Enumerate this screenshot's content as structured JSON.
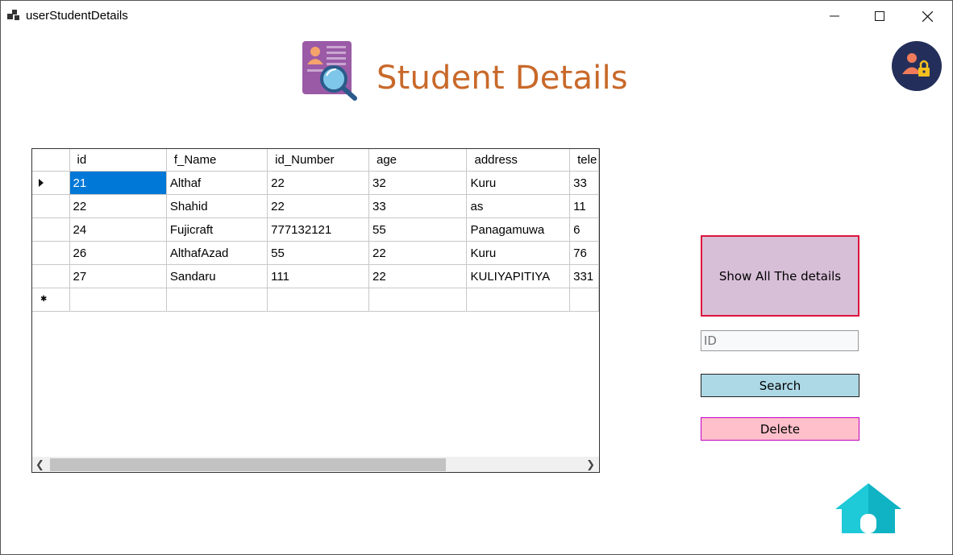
{
  "window": {
    "title": "userStudentDetails",
    "app_icon": "grid-app-icon",
    "controls": [
      "minimize-icon",
      "maximize-icon",
      "close-icon"
    ]
  },
  "header": {
    "title": "Student Details",
    "icon": "student-search-icon",
    "title_color": "#c8692a"
  },
  "avatar": {
    "icon": "user-lock-icon"
  },
  "grid": {
    "columns": [
      "id",
      "f_Name",
      "id_Number",
      "age",
      "address",
      "tele"
    ],
    "rows": [
      [
        "21",
        "Althaf",
        "22",
        "32",
        "Kuru",
        "33"
      ],
      [
        "22",
        "Shahid",
        "22",
        "33",
        "as",
        "11"
      ],
      [
        "24",
        "Fujicraft",
        "777132121",
        "55",
        "Panagamuwa",
        "6"
      ],
      [
        "26",
        "AlthafAzad",
        "55",
        "22",
        "Kuru",
        "76"
      ],
      [
        "27",
        "Sandaru",
        "111",
        "22",
        "KULIYAPITIYA",
        "331"
      ]
    ],
    "selected_cell": {
      "row": 0,
      "column": 0
    },
    "selection_color": "#0078d7"
  },
  "controls": {
    "show_all_label": "Show All The details",
    "id_placeholder": "ID",
    "search_label": "Search",
    "delete_label": "Delete"
  },
  "home": {
    "icon": "home-icon",
    "color": "#1ec9d8"
  }
}
